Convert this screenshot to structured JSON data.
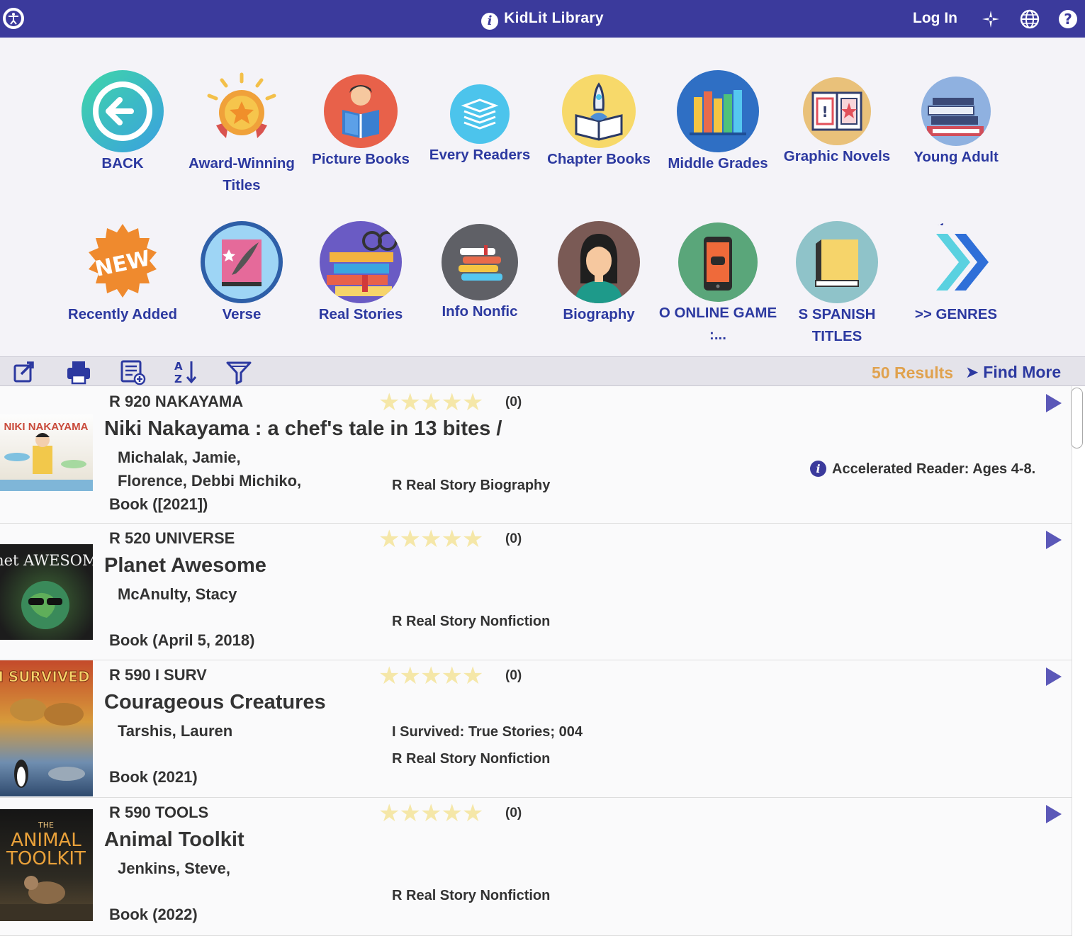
{
  "header": {
    "title": "KidLit Library",
    "login_label": "Log In",
    "icons": [
      "accessibility-icon",
      "info-icon",
      "sparkle-icon",
      "globe-icon",
      "help-icon"
    ]
  },
  "categories": [
    {
      "label": "BACK",
      "icon": "back-arrow-icon"
    },
    {
      "label": "Award-Winning Titles",
      "icon": "award-medal-icon"
    },
    {
      "label": "Picture Books",
      "icon": "child-reading-icon"
    },
    {
      "label": "Every Readers",
      "icon": "book-stack-icon"
    },
    {
      "label": "Chapter Books",
      "icon": "rocket-book-icon"
    },
    {
      "label": "Middle Grades",
      "icon": "bookshelf-icon"
    },
    {
      "label": "Graphic Novels",
      "icon": "comic-book-icon"
    },
    {
      "label": "Young Adult",
      "icon": "stacked-books-icon"
    },
    {
      "label": "Recently Added",
      "icon": "new-badge-icon",
      "badge_text": "NEW"
    },
    {
      "label": "Verse",
      "icon": "quill-book-icon"
    },
    {
      "label": "Real Stories",
      "icon": "books-glasses-icon"
    },
    {
      "label": "Info Nonfic",
      "icon": "info-books-icon"
    },
    {
      "label": "Biography",
      "icon": "person-portrait-icon"
    },
    {
      "label": "O ONLINE GAME :...",
      "icon": "phone-game-icon"
    },
    {
      "label": "S SPANISH TITLES",
      "icon": "yellow-book-icon"
    },
    {
      "label": ">> GENRES",
      "icon": "double-chevron-icon"
    }
  ],
  "toolbar": {
    "icons": [
      "share-icon",
      "print-icon",
      "add-list-icon",
      "sort-az-icon",
      "filter-icon"
    ],
    "results_label": "50 Results",
    "find_more_label": "Find More"
  },
  "results": [
    {
      "call_number": "R 920 NAKAYAMA",
      "title": "Niki Nakayama : a chef's tale in 13 bites /",
      "authors": [
        "Michalak, Jamie,",
        "Florence, Debbi Michiko,"
      ],
      "format": "Book ([2021])",
      "rating_count": "(0)",
      "rating": 0,
      "meta": [
        "R Real Story Biography"
      ],
      "ar_text": "Accelerated Reader:  Ages 4-8.",
      "cover_text": "NIKI NAKAYAMA",
      "cover_colors": [
        "#fdfdfd",
        "#e8e2d4"
      ]
    },
    {
      "call_number": "R 520 UNIVERSE",
      "title": "Planet Awesome",
      "authors": [
        "McAnulty, Stacy"
      ],
      "format": "Book (April 5, 2018)",
      "rating_count": "(0)",
      "rating": 0,
      "meta": [
        "R Real Story Nonfiction"
      ],
      "cover_text": "Planet AWESOME!",
      "cover_colors": [
        "#1c1c1c",
        "#3f6a37"
      ]
    },
    {
      "call_number": "R 590 I SURV",
      "title": "Courageous Creatures",
      "authors": [
        "Tarshis, Lauren"
      ],
      "format": "Book (2021)",
      "rating_count": "(0)",
      "rating": 0,
      "meta": [
        "I Survived: True Stories; 004",
        "R Real Story Nonfiction"
      ],
      "cover_text": "I SURVIVED",
      "cover_colors": [
        "#c44a2a",
        "#d79a3b"
      ]
    },
    {
      "call_number": "R 590 TOOLS",
      "title": "Animal Toolkit",
      "authors": [
        "Jenkins, Steve,"
      ],
      "format": "Book (2022)",
      "rating_count": "(0)",
      "rating": 0,
      "meta": [
        "R Real Story Nonfiction"
      ],
      "cover_text": "THE ANIMAL TOOLKIT",
      "cover_colors": [
        "#151515",
        "#5a4a32"
      ]
    }
  ]
}
